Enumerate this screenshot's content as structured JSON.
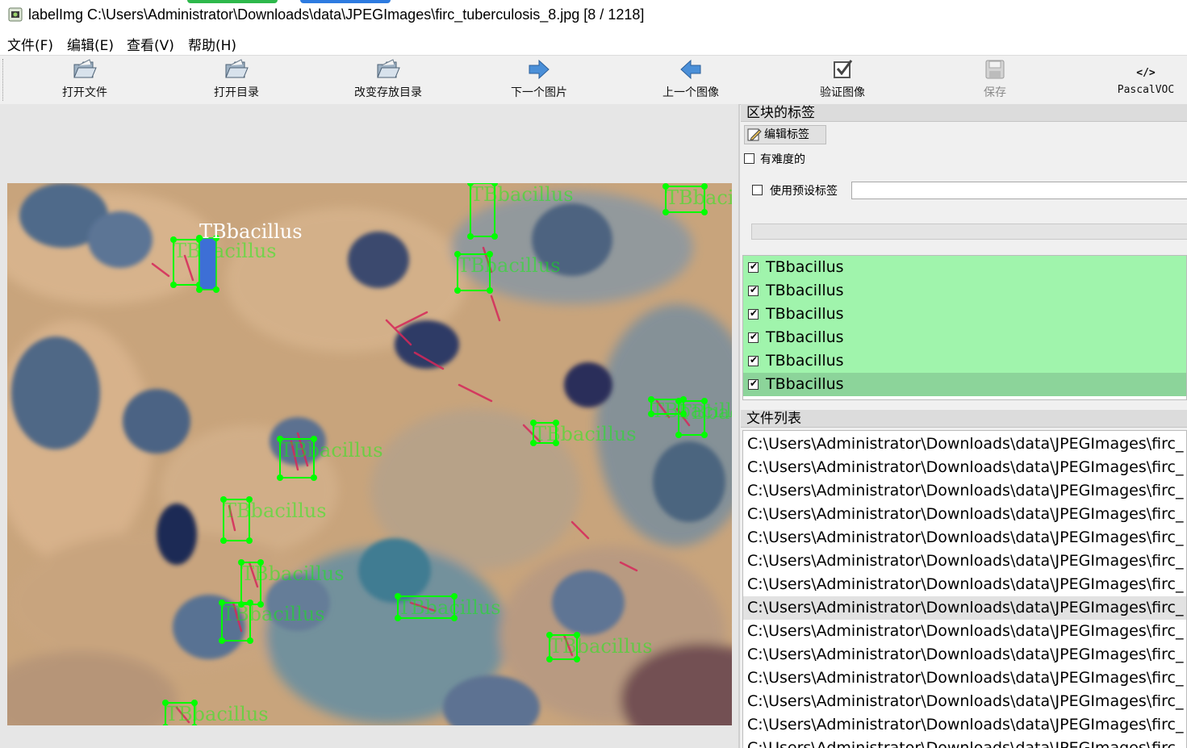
{
  "window": {
    "title": "labelImg C:\\Users\\Administrator\\Downloads\\data\\JPEGImages\\firc_tuberculosis_8.jpg [8 / 1218]"
  },
  "menu": [
    "文件(F)",
    "编辑(E)",
    "查看(V)",
    "帮助(H)"
  ],
  "toolbar": {
    "open_file": "打开文件",
    "open_dir": "打开目录",
    "change_save_dir": "改变存放目录",
    "next_image": "下一个图片",
    "prev_image": "上一个图像",
    "verify_image": "验证图像",
    "save": "保存",
    "format": "PascalVOC"
  },
  "canvas": {
    "selected_label": "TBbacillus",
    "box_label": "TBbacillus"
  },
  "label_panel": {
    "title": "区块的标签",
    "edit_label_button": "编辑标签",
    "difficult_label": "有难度的",
    "use_default_label": "使用预设标签",
    "default_label_value": "",
    "labels": [
      "TBbacillus",
      "TBbacillus",
      "TBbacillus",
      "TBbacillus",
      "TBbacillus",
      "TBbacillus"
    ]
  },
  "file_panel": {
    "title": "文件列表",
    "files": [
      "C:\\Users\\Administrator\\Downloads\\data\\JPEGImages\\firc_",
      "C:\\Users\\Administrator\\Downloads\\data\\JPEGImages\\firc_",
      "C:\\Users\\Administrator\\Downloads\\data\\JPEGImages\\firc_",
      "C:\\Users\\Administrator\\Downloads\\data\\JPEGImages\\firc_",
      "C:\\Users\\Administrator\\Downloads\\data\\JPEGImages\\firc_",
      "C:\\Users\\Administrator\\Downloads\\data\\JPEGImages\\firc_",
      "C:\\Users\\Administrator\\Downloads\\data\\JPEGImages\\firc_",
      "C:\\Users\\Administrator\\Downloads\\data\\JPEGImages\\firc_",
      "C:\\Users\\Administrator\\Downloads\\data\\JPEGImages\\firc_",
      "C:\\Users\\Administrator\\Downloads\\data\\JPEGImages\\firc_",
      "C:\\Users\\Administrator\\Downloads\\data\\JPEGImages\\firc_",
      "C:\\Users\\Administrator\\Downloads\\data\\JPEGImages\\firc_",
      "C:\\Users\\Administrator\\Downloads\\data\\JPEGImages\\firc_",
      "C:\\Users\\Administrator\\Downloads\\data\\JPEGImages\\firc_"
    ]
  },
  "colors": {
    "box_green": "#00ff00",
    "selected_fill": "#3d6fd6",
    "label_list_bg": "#a0f4ac",
    "label_list_selected": "#8cd49a"
  }
}
